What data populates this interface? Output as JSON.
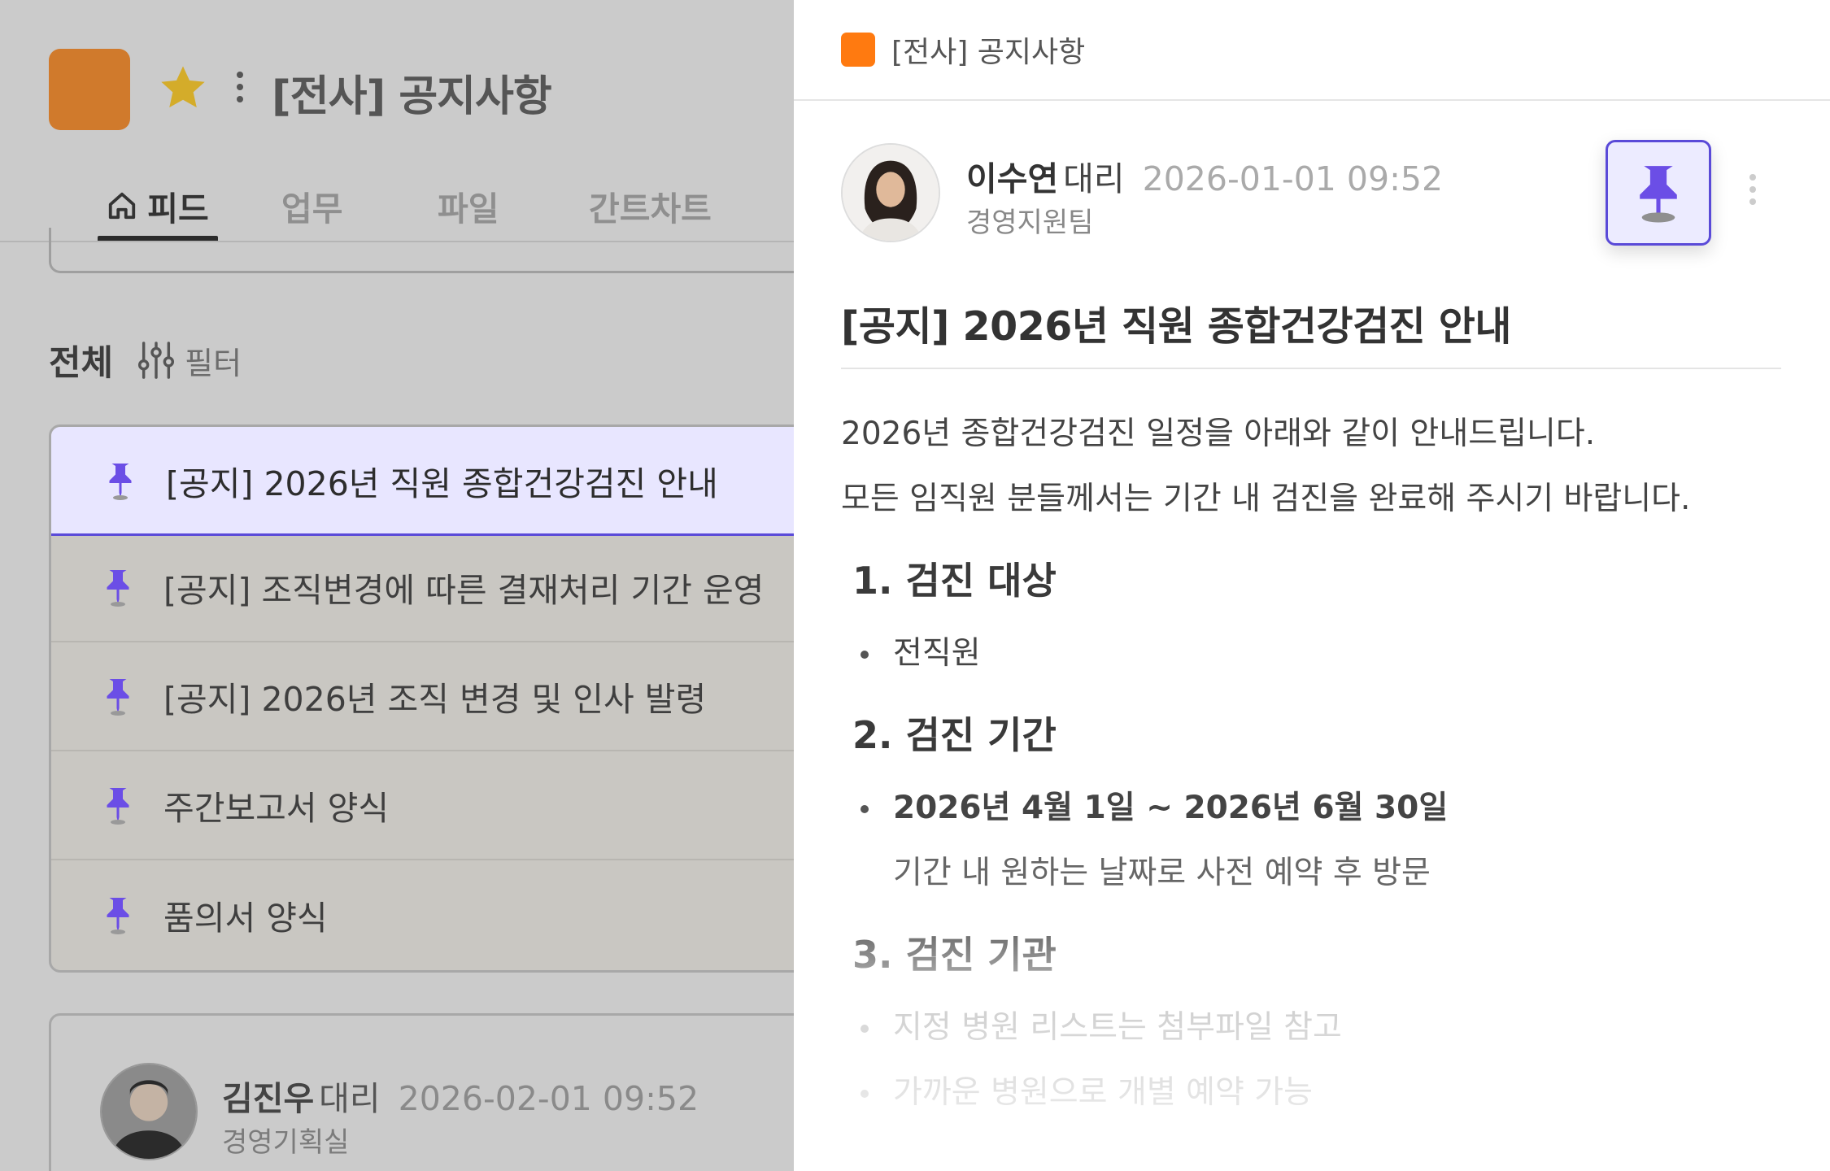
{
  "room": {
    "title": "[전사] 공지사항",
    "color": "#d07a2c"
  },
  "tabs": [
    {
      "label": "피드",
      "icon": "home-icon",
      "active": true
    },
    {
      "label": "업무"
    },
    {
      "label": "파일"
    },
    {
      "label": "간트차트"
    }
  ],
  "filter": {
    "title": "전체",
    "label": "필터",
    "icon": "filter-sliders-icon"
  },
  "pinned_items": [
    {
      "label": "[공지] 2026년 직원 종합건강검진 안내",
      "selected": true
    },
    {
      "label": "[공지] 조직변경에 따른 결재처리 기간 운영"
    },
    {
      "label": "[공지] 2026년 조직 변경 및 인사 발령"
    },
    {
      "label": "주간보고서 양식"
    },
    {
      "label": "품의서 양식"
    }
  ],
  "feed_post": {
    "author": "김진우",
    "rank": "대리",
    "datetime": "2026-02-01 09:52",
    "team": "경영기획실"
  },
  "panel": {
    "room_title": "[전사] 공지사항",
    "room_color": "#ff7a10",
    "author": "이수연",
    "rank": "대리",
    "datetime": "2026-01-01 09:52",
    "team": "경영지원팀",
    "pin_color": "#5a4ad8",
    "post_title": "[공지] 2026년 직원 종합건강검진 안내",
    "paragraphs": [
      "2026년 종합건강검진 일정을 아래와 같이 안내드립니다.",
      "모든 임직원 분들께서는 기간 내 검진을 완료해 주시기 바랍니다."
    ],
    "sections": [
      {
        "heading": "1. 검진 대상",
        "bullets": [
          "전직원"
        ]
      },
      {
        "heading": "2. 검진 기간",
        "bullets": [
          "2026년 4월 1일 ~ 2026년 6월 30일"
        ],
        "note": "기간 내 원하는 날짜로 사전 예약 후 방문"
      },
      {
        "heading": "3. 검진 기관",
        "bullets": [
          "지정 병원 리스트는 첨부파일 참고",
          "가까운 병원으로 개별 예약 가능"
        ]
      }
    ]
  }
}
